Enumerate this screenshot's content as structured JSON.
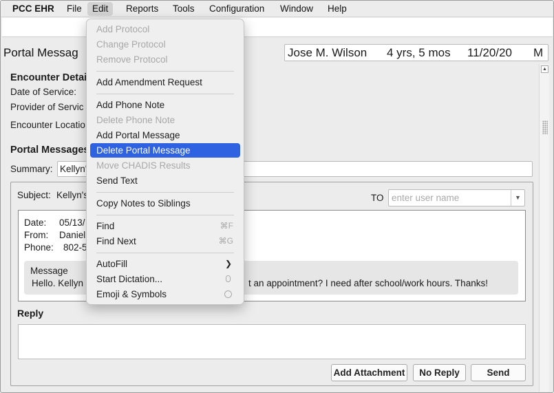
{
  "menubar": {
    "app": "PCC EHR",
    "items": [
      "File",
      "Edit",
      "Reports",
      "Tools",
      "Configuration",
      "Window",
      "Help"
    ],
    "active": "Edit"
  },
  "page": {
    "title": "Portal Messag"
  },
  "patient": {
    "name": "Jose M. Wilson",
    "age": "4 yrs, 5 mos",
    "dob": "11/20/20",
    "sex": "M"
  },
  "encounter": {
    "heading": "Encounter Detail",
    "date_label": "Date of Service:",
    "provider_label": "Provider of Servic",
    "location_label": "Encounter Locatio"
  },
  "portal": {
    "heading": "Portal Messages",
    "summary_label": "Summary:",
    "summary_value": "Kellyn'",
    "subject_label": "Subject:",
    "subject_value": "Kellyn's",
    "to_label": "TO",
    "to_placeholder": "enter user name",
    "message": {
      "date_label": "Date:",
      "date_value": "05/13/",
      "from_label": "From:",
      "from_value": "Daniel",
      "phone_label": "Phone:",
      "phone_value": "802-55",
      "body_label": "Message",
      "body_start": "Hello. Kellyn",
      "body_end": "t an appointment? I need after school/work hours. Thanks!"
    },
    "reply_label": "Reply",
    "buttons": {
      "attach": "Add Attachment",
      "no_reply": "No Reply",
      "send": "Send"
    }
  },
  "edit_menu": {
    "add_protocol": "Add Protocol",
    "change_protocol": "Change Protocol",
    "remove_protocol": "Remove Protocol",
    "add_amendment": "Add Amendment Request",
    "add_phone_note": "Add Phone Note",
    "delete_phone_note": "Delete Phone Note",
    "add_portal_message": "Add Portal Message",
    "delete_portal_message": "Delete Portal Message",
    "move_chadis": "Move CHADIS Results",
    "send_text": "Send Text",
    "copy_notes": "Copy Notes to Siblings",
    "find": "Find",
    "find_shortcut": "⌘F",
    "find_next": "Find Next",
    "find_next_shortcut": "⌘G",
    "autofill": "AutoFill",
    "start_dictation": "Start Dictation...",
    "emoji_symbols": "Emoji & Symbols"
  },
  "colors": {
    "highlight": "#2f62e0",
    "disabled_text": "#a8a8a8",
    "background": "#ececec"
  }
}
